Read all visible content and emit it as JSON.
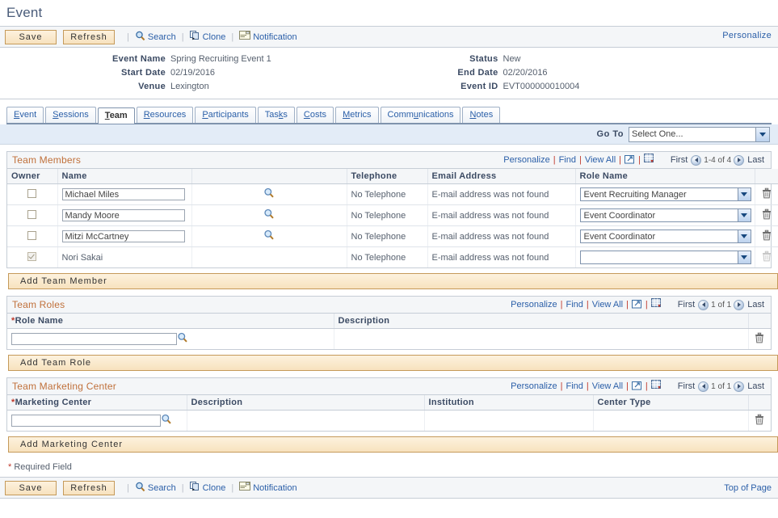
{
  "page": {
    "title": "Event",
    "personalize_link": "Personalize",
    "required_note": "Required Field",
    "required_star": "*",
    "top_of_page": "Top of Page"
  },
  "toolbar": {
    "save_label": "Save",
    "refresh_label": "Refresh",
    "search_label": "Search",
    "clone_label": "Clone",
    "notification_label": "Notification",
    "separator": "|"
  },
  "header": {
    "left": [
      {
        "label": "Event Name",
        "value": "Spring Recruiting Event 1"
      },
      {
        "label": "Start Date",
        "value": "02/19/2016"
      },
      {
        "label": "Venue",
        "value": "Lexington"
      }
    ],
    "right": [
      {
        "label": "Status",
        "value": "New"
      },
      {
        "label": "End Date",
        "value": "02/20/2016"
      },
      {
        "label": "Event ID",
        "value": "EVT000000010004"
      }
    ]
  },
  "tabs": [
    {
      "label": "Event",
      "accesskey": "E",
      "active": false
    },
    {
      "label": "Sessions",
      "accesskey": "S",
      "active": false
    },
    {
      "label": "Team",
      "accesskey": "T",
      "active": true
    },
    {
      "label": "Resources",
      "accesskey": "R",
      "active": false
    },
    {
      "label": "Participants",
      "accesskey": "P",
      "active": false
    },
    {
      "label": "Tasks",
      "accesskey": "k",
      "active": false
    },
    {
      "label": "Costs",
      "accesskey": "C",
      "active": false
    },
    {
      "label": "Metrics",
      "accesskey": "M",
      "active": false
    },
    {
      "label": "Communications",
      "accesskey": "u",
      "active": false
    },
    {
      "label": "Notes",
      "accesskey": "N",
      "active": false
    }
  ],
  "goto": {
    "label": "Go To",
    "value": "Select One...",
    "options": [
      "Select One..."
    ]
  },
  "grid_nav": {
    "personalize": "Personalize",
    "find": "Find",
    "view_all": "View All",
    "expand_icon": "expand-window-icon",
    "download_icon": "download-spreadsheet-icon",
    "first": "First",
    "last": "Last"
  },
  "team_members": {
    "title": "Team Members",
    "count_text": "1-4 of 4",
    "columns": [
      "Owner",
      "Name",
      "",
      "Telephone",
      "Email Address",
      "Role Name",
      ""
    ],
    "role_options": [
      "Event Recruiting Manager",
      "Event Coordinator",
      ""
    ],
    "rows": [
      {
        "owner_checked": false,
        "owner_disabled": false,
        "name": "Michael Miles",
        "has_lookup": true,
        "telephone": "No Telephone",
        "email": "E-mail address was not found",
        "role": "Event Recruiting Manager",
        "delete_disabled": false
      },
      {
        "owner_checked": false,
        "owner_disabled": false,
        "name": "Mandy Moore",
        "has_lookup": true,
        "telephone": "No Telephone",
        "email": "E-mail address was not found",
        "role": "Event Coordinator",
        "delete_disabled": false
      },
      {
        "owner_checked": false,
        "owner_disabled": false,
        "name": "Mitzi McCartney",
        "has_lookup": true,
        "telephone": "No Telephone",
        "email": "E-mail address was not found",
        "role": "Event Coordinator",
        "delete_disabled": false
      },
      {
        "owner_checked": true,
        "owner_disabled": true,
        "name": "Nori Sakai",
        "has_lookup": false,
        "telephone": "No Telephone",
        "email": "E-mail address was not found",
        "role": "",
        "delete_disabled": true
      }
    ],
    "add_button": "Add Team Member"
  },
  "team_roles": {
    "title": "Team Roles",
    "count_text": "1 of 1",
    "columns": [
      "Role Name",
      "Description",
      ""
    ],
    "role_name_required": true,
    "rows": [
      {
        "role_name": "",
        "role_name_placeholder": "",
        "description": ""
      }
    ],
    "add_button": "Add Team Role"
  },
  "team_marketing_center": {
    "title": "Team Marketing Center",
    "count_text": "1 of 1",
    "columns": [
      "Marketing Center",
      "Description",
      "Institution",
      "Center Type",
      ""
    ],
    "marketing_center_required": true,
    "rows": [
      {
        "marketing_center": "",
        "description": "",
        "institution": "",
        "center_type": ""
      }
    ],
    "add_button": "Add Marketing Center"
  },
  "colors": {
    "accent_link": "#2b5fa8",
    "section_title": "#c0703a",
    "button_face": "#f7e2be",
    "button_border": "#c59a5a",
    "header_label": "#3b4a63",
    "goto_bar": "#e3ecf7"
  }
}
